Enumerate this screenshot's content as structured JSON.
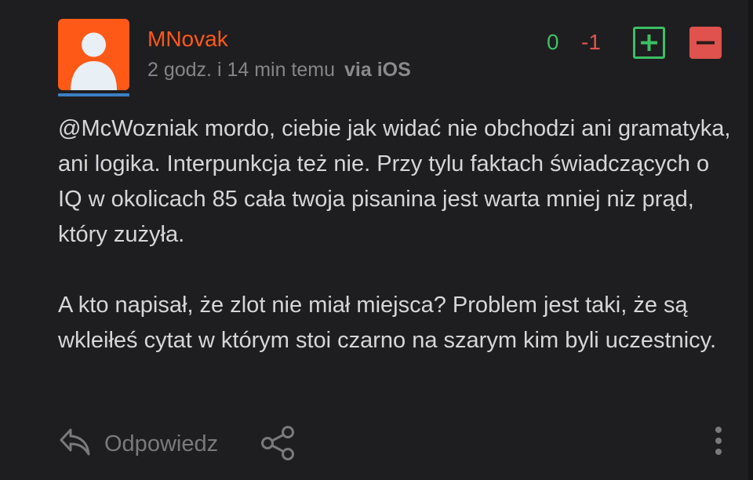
{
  "comment": {
    "author": "MNovak",
    "time": "2 godz. i 14 min temu",
    "via": "via iOS",
    "score_plus": "0",
    "score_minus": "-1",
    "mention": "@McWozniak",
    "paragraph1_rest": " mordo, ciebie jak widać nie obchodzi ani gramatyka, ani logika. Interpunkcja też nie. Przy tylu faktach świadczących o IQ w okolicach 85 cała twoja pisanina jest warta mniej niz prąd, który zużyła.",
    "paragraph2": "A kto napisał, że zlot nie miał miejsca? Problem jest taki, że są wkleiłeś cytat w którym stoi czarno na szarym kim byli uczestnicy."
  },
  "actions": {
    "reply_label": "Odpowiedz"
  },
  "icons": {
    "avatar": "user-silhouette-icon",
    "vote_up": "plus-icon",
    "vote_down": "minus-icon",
    "reply": "reply-arrow-icon",
    "share": "share-icon",
    "more": "vertical-dots-icon"
  },
  "colors": {
    "background": "#1e1e20",
    "brand": "#ff5917",
    "positive": "#3cbf63",
    "negative": "#e0524d",
    "avatar_underline": "#3b7fc4"
  }
}
